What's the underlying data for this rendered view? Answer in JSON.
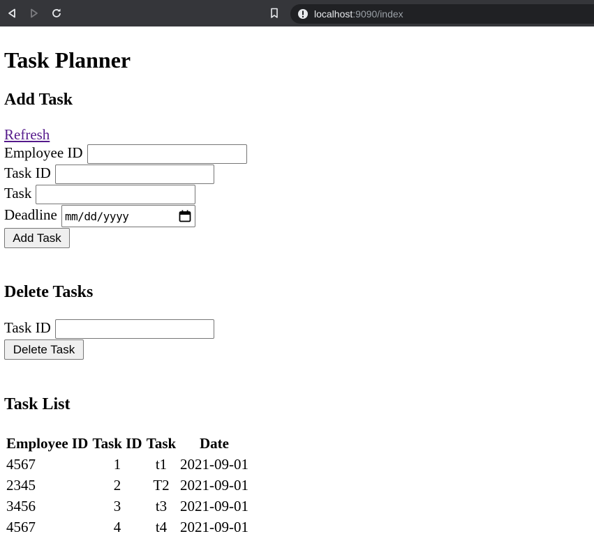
{
  "browser": {
    "url_host": "localhost",
    "url_path": ":9090/index"
  },
  "page": {
    "title": "Task Planner",
    "add_section": {
      "heading": "Add Task",
      "refresh_link": "Refresh",
      "employee_id_label": "Employee ID",
      "employee_id_value": "",
      "task_id_label": "Task ID",
      "task_id_value": "",
      "task_label": "Task",
      "task_value": "",
      "deadline_label": "Deadline",
      "deadline_placeholder": "mm/dd/yyyy",
      "submit_label": "Add Task"
    },
    "delete_section": {
      "heading": "Delete Tasks",
      "task_id_label": "Task ID",
      "task_id_value": "",
      "submit_label": "Delete Task"
    },
    "list_section": {
      "heading": "Task List",
      "columns": [
        "Employee ID",
        "Task ID",
        "Task",
        "Date"
      ],
      "rows": [
        [
          "4567",
          "1",
          "t1",
          "2021-09-01"
        ],
        [
          "2345",
          "2",
          "T2",
          "2021-09-01"
        ],
        [
          "3456",
          "3",
          "t3",
          "2021-09-01"
        ],
        [
          "4567",
          "4",
          "t4",
          "2021-09-01"
        ]
      ]
    }
  }
}
